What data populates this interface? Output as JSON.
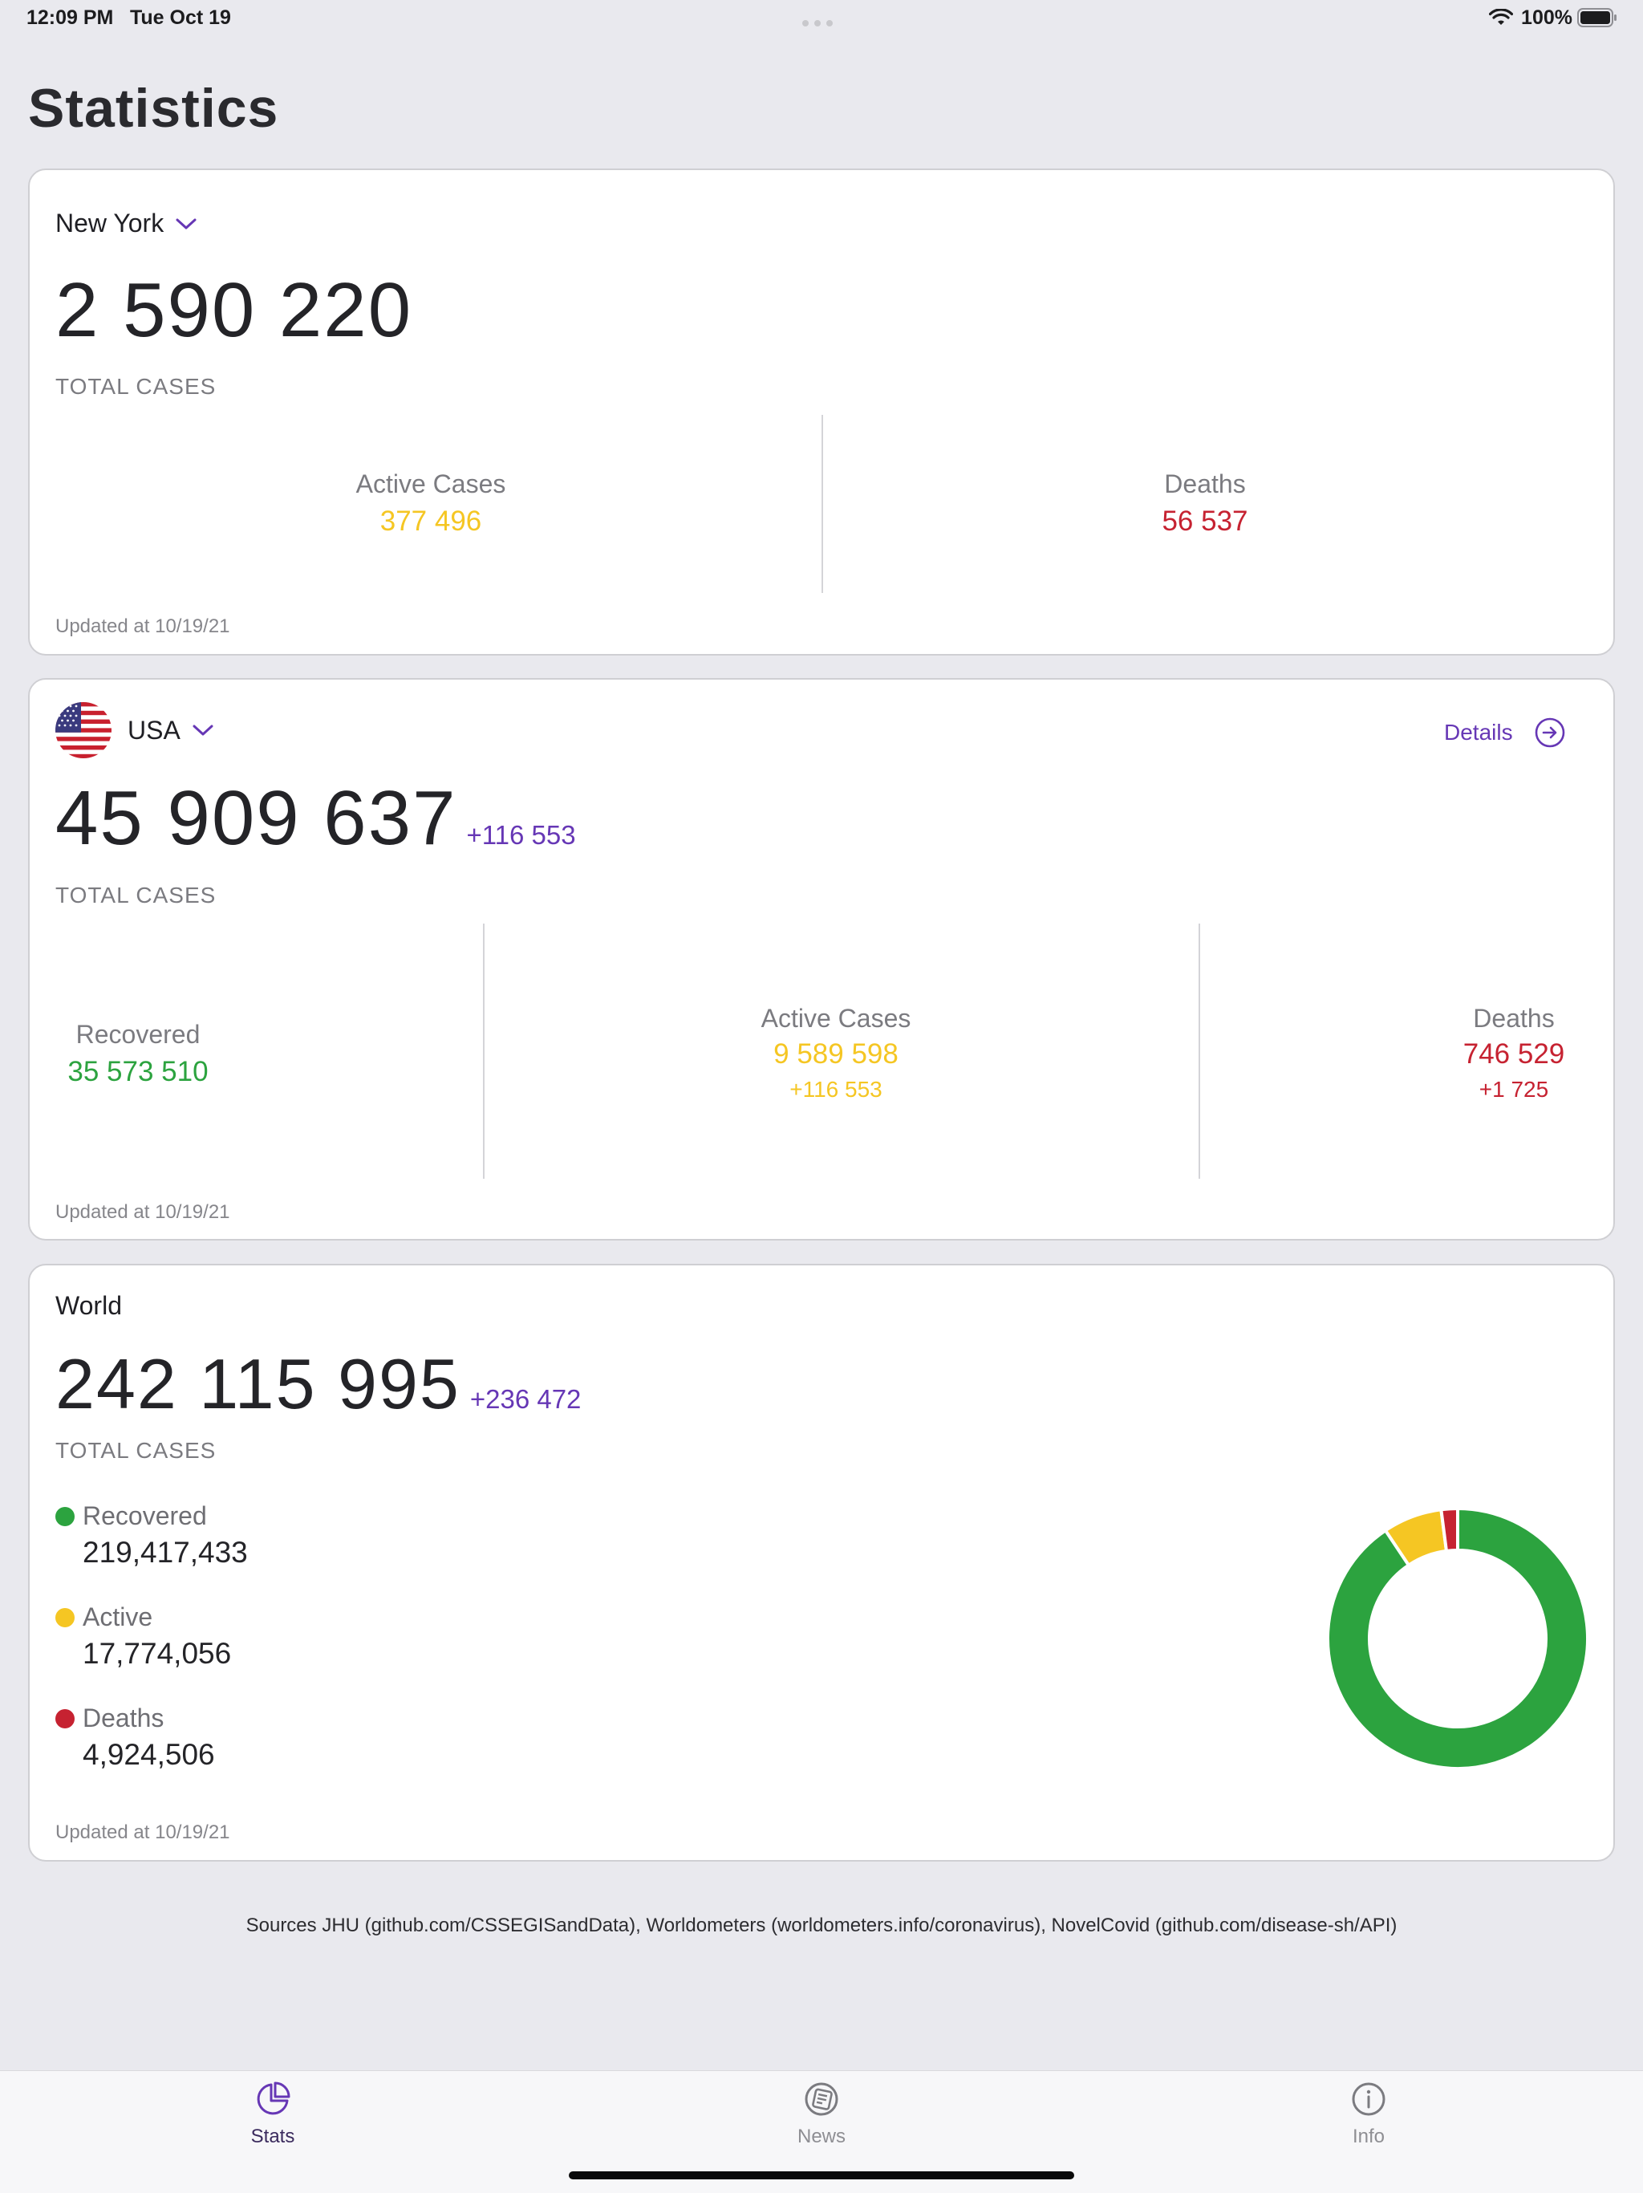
{
  "status_bar": {
    "time": "12:09 PM",
    "date": "Tue Oct 19",
    "battery": "100%"
  },
  "page": {
    "title": "Statistics"
  },
  "colors": {
    "accent": "#6637B5",
    "active": "#F5C623",
    "deaths": "#C62231",
    "recovered": "#2CA33F"
  },
  "new_york": {
    "region": "New York",
    "total": "2 590 220",
    "total_label": "TOTAL CASES",
    "active_label": "Active Cases",
    "active_value": "377 496",
    "deaths_label": "Deaths",
    "deaths_value": "56 537",
    "updated": "Updated at 10/19/21"
  },
  "usa": {
    "region": "USA",
    "details_label": "Details",
    "total": "45 909 637",
    "total_delta": "+116 553",
    "total_label": "TOTAL CASES",
    "recovered_label": "Recovered",
    "recovered_value": "35 573 510",
    "active_label": "Active Cases",
    "active_value": "9 589 598",
    "active_delta": "+116 553",
    "deaths_label": "Deaths",
    "deaths_value": "746 529",
    "deaths_delta": "+1 725",
    "updated": "Updated at 10/19/21"
  },
  "world": {
    "region": "World",
    "total": "242 115 995",
    "total_delta": "+236 472",
    "total_label": "TOTAL CASES",
    "legend": [
      {
        "label": "Recovered",
        "value": "219,417,433"
      },
      {
        "label": "Active",
        "value": "17,774,056"
      },
      {
        "label": "Deaths",
        "value": "4,924,506"
      }
    ],
    "updated": "Updated at 10/19/21"
  },
  "chart_data": {
    "type": "pie",
    "categories": [
      "Recovered",
      "Active",
      "Deaths"
    ],
    "values": [
      219417433,
      17774056,
      4924506
    ],
    "colors": [
      "#2CA33F",
      "#F5C623",
      "#C62231"
    ]
  },
  "sources": "Sources JHU (github.com/CSSEGISandData), Worldometers (worldometers.info/coronavirus), NovelCovid (github.com/disease-sh/API)",
  "tabs": [
    {
      "label": "Stats",
      "icon": "pie-chart-icon"
    },
    {
      "label": "News",
      "icon": "news-icon"
    },
    {
      "label": "Info",
      "icon": "info-icon"
    }
  ]
}
